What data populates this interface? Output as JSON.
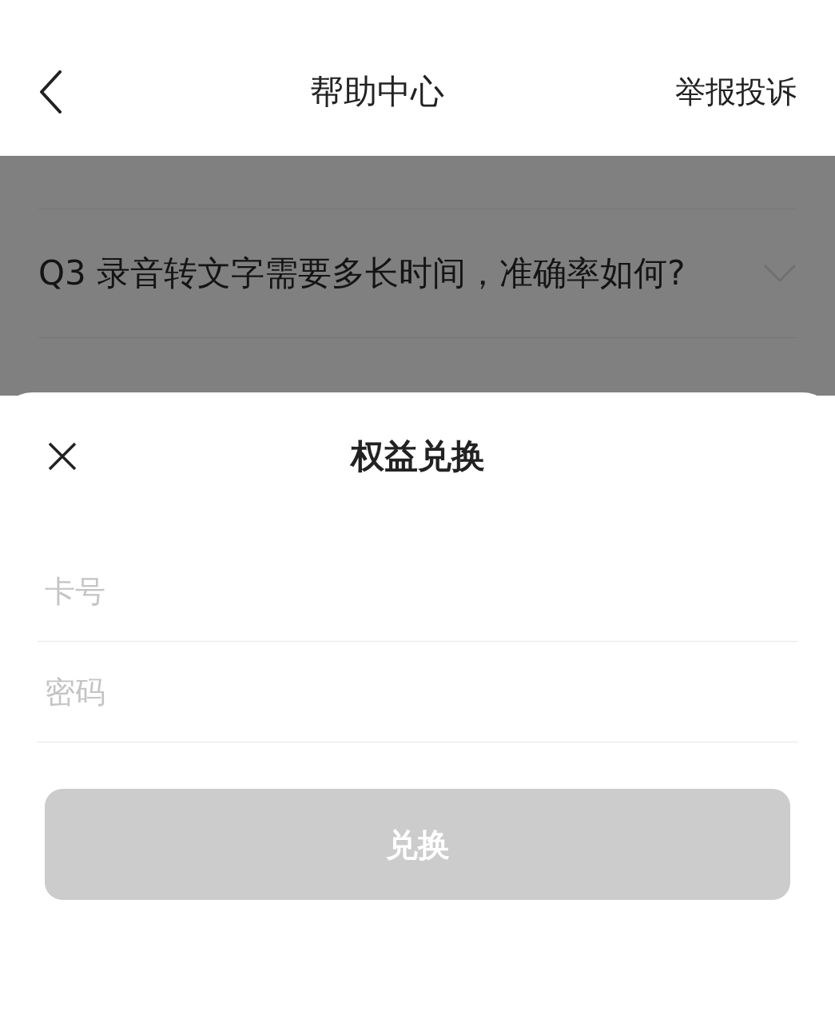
{
  "nav": {
    "title": "帮助中心",
    "action": "举报投诉"
  },
  "faq": [
    {
      "question": "Q3 录音转文字需要多长时间，准确率如何?",
      "expanded": false
    }
  ],
  "sheet": {
    "title": "权益兑换",
    "fields": [
      {
        "placeholder": "卡号"
      },
      {
        "placeholder": "密码"
      }
    ],
    "submit": {
      "label": "兑换",
      "disabled": true
    }
  }
}
